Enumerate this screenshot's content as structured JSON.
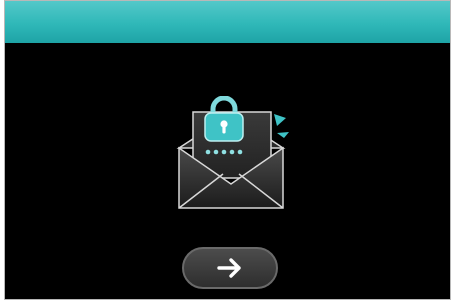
{
  "colors": {
    "title_bar": "#2fb8b8",
    "background": "#000000",
    "accent": "#2fb8b8",
    "envelope": "#3a3a3a",
    "button": "#3a3a3a"
  },
  "illustration": {
    "icon": "secure-mail-icon",
    "lock_icon": "padlock-icon",
    "masked_password": "*****"
  },
  "next_button": {
    "icon": "arrow-right-icon"
  }
}
